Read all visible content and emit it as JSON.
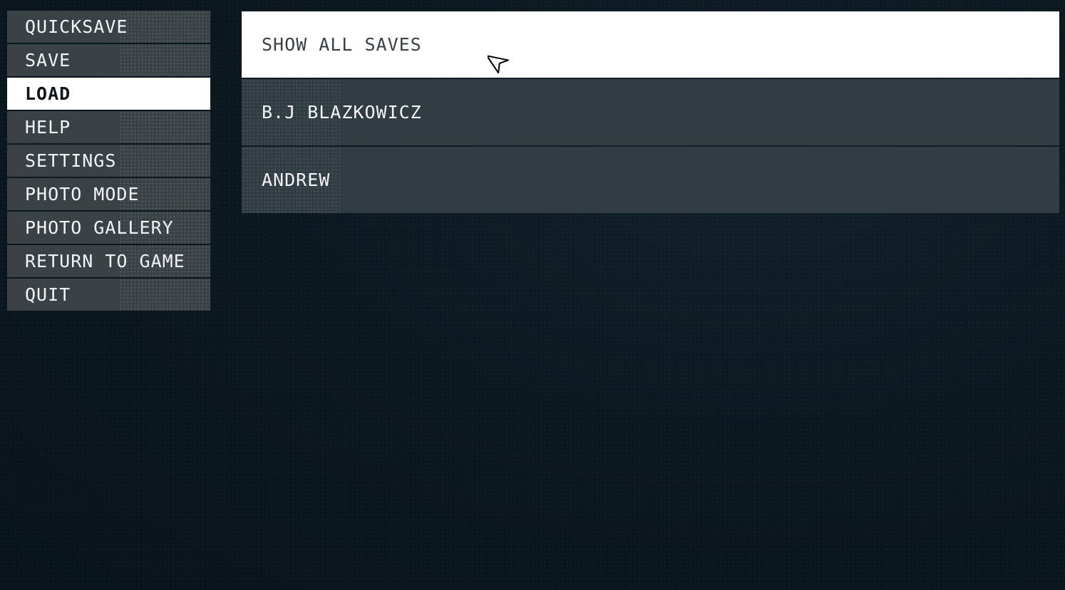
{
  "menu": {
    "items": [
      {
        "label": "QUICKSAVE",
        "active": false
      },
      {
        "label": "SAVE",
        "active": false
      },
      {
        "label": "LOAD",
        "active": true
      },
      {
        "label": "HELP",
        "active": false
      },
      {
        "label": "SETTINGS",
        "active": false
      },
      {
        "label": "PHOTO MODE",
        "active": false
      },
      {
        "label": "PHOTO GALLERY",
        "active": false
      },
      {
        "label": "RETURN TO GAME",
        "active": false
      },
      {
        "label": "QUIT",
        "active": false
      }
    ]
  },
  "load_panel": {
    "rows": [
      {
        "label": "SHOW ALL SAVES",
        "highlighted": true
      },
      {
        "label": "B.J BLAZKOWICZ",
        "highlighted": false
      },
      {
        "label": "ANDREW",
        "highlighted": false
      }
    ]
  },
  "colors": {
    "background": "#0c1820",
    "menu_item_bg": "#3a4246",
    "active_bg": "#ffffff",
    "save_row_bg": "#313c43",
    "text_light": "#f2f4f5",
    "text_dark": "#111417"
  },
  "cursor": {
    "icon": "pointer-arrow-icon"
  }
}
